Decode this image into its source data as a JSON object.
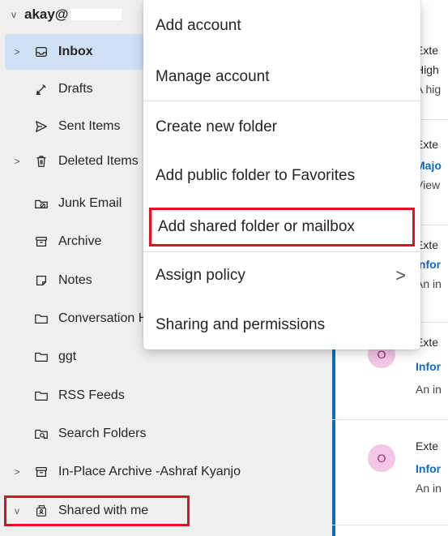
{
  "account": {
    "name": "akay@",
    "caret": "v"
  },
  "folders": [
    {
      "label": "Inbox",
      "icon": "inbox-icon",
      "caret": ">",
      "selected": true
    },
    {
      "label": "Drafts",
      "icon": "drafts-icon"
    },
    {
      "label": "Sent Items",
      "icon": "send-icon"
    },
    {
      "label": "Deleted Items",
      "icon": "trash-icon",
      "caret": ">"
    },
    {
      "label": "Junk Email",
      "icon": "junk-icon"
    },
    {
      "label": "Archive",
      "icon": "archive-icon"
    },
    {
      "label": "Notes",
      "icon": "notes-icon"
    },
    {
      "label": "Conversation History",
      "icon": "folder-icon"
    },
    {
      "label": "ggt",
      "icon": "folder-icon"
    },
    {
      "label": "RSS Feeds",
      "icon": "folder-icon"
    },
    {
      "label": "Search Folders",
      "icon": "search-folder-icon"
    },
    {
      "label": "In-Place Archive -Ashraf Kyanjo",
      "icon": "archive-icon",
      "caret": ">"
    },
    {
      "label": "Shared with me",
      "icon": "shared-folder-icon",
      "caret": "v"
    }
  ],
  "menu": {
    "items": [
      {
        "label": "Add account"
      },
      {
        "label": "Manage account"
      },
      {
        "label": "Create new folder"
      },
      {
        "label": "Add public folder to Favorites"
      },
      {
        "label": "Add shared folder or mailbox",
        "highlighted": true
      },
      {
        "label": "Assign policy",
        "submenu": ">"
      },
      {
        "label": "Sharing and permissions"
      }
    ]
  },
  "messages": [
    {
      "sender": "Exte",
      "subject": "High",
      "preview": "A hig"
    },
    {
      "sender": "Exte",
      "subject": "Majo",
      "preview": "View"
    },
    {
      "sender": "Exte",
      "subject": "Infor",
      "preview": "An in"
    },
    {
      "sender": "Exte",
      "subject": "Infor",
      "preview": "An in",
      "avatar": "O"
    },
    {
      "sender": "Exte",
      "subject": "Infor",
      "preview": "An in",
      "avatar": "O"
    }
  ],
  "colors": {
    "accent": "#0f6cbd",
    "highlight_box": "#e01020",
    "selected_bg": "#cfe0f4"
  }
}
